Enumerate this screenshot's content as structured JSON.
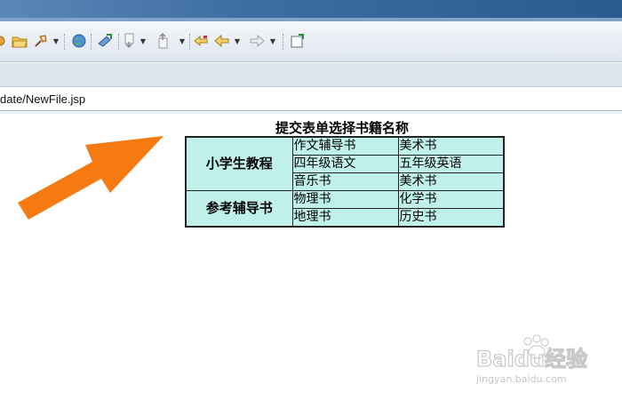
{
  "address": {
    "path": "date/NewFile.jsp"
  },
  "page": {
    "title": "提交表单选择书籍名称"
  },
  "book_table": {
    "groups": [
      {
        "label": "小学生教程",
        "rows": [
          [
            "作文辅导书",
            "美术书"
          ],
          [
            "四年级语文",
            "五年级英语"
          ],
          [
            "音乐书",
            "美术书"
          ]
        ]
      },
      {
        "label": "参考辅导书",
        "rows": [
          [
            "物理书",
            "化学书"
          ],
          [
            "地理书",
            "历史书"
          ]
        ]
      }
    ]
  },
  "toolbar": {
    "icons": [
      "save-icon",
      "open-folder-icon",
      "run-icon",
      "globe-icon",
      "debug-icon",
      "next-annotation-icon",
      "prev-annotation-icon",
      "last-edit-icon",
      "back-icon",
      "forward-icon",
      "pin-editor-icon"
    ]
  },
  "watermark": {
    "brand": "Baidu经验",
    "url": "jingyan.baidu.com"
  },
  "colors": {
    "table_bg": "#bff0ea",
    "arrow": "#f57a12",
    "titlebar": "#3d6da3"
  }
}
